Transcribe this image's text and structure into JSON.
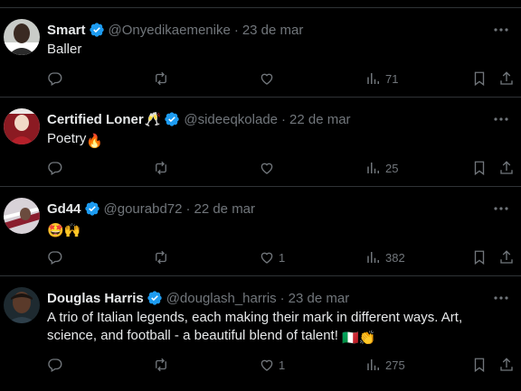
{
  "replies": [
    {
      "name": "Smart",
      "name_emoji": "",
      "handle": "@Onyedikaemenike",
      "date": "23 de mar",
      "text": "Baller",
      "text_emoji": "",
      "reply_count": "",
      "repost_count": "",
      "like_count": "",
      "views": "71"
    },
    {
      "name": "Certified Loner",
      "name_emoji": "🥂",
      "handle": "@sideeqkolade",
      "date": "22 de mar",
      "text": "Poetry",
      "text_emoji": "🔥",
      "reply_count": "",
      "repost_count": "",
      "like_count": "",
      "views": "25"
    },
    {
      "name": "Gd44",
      "name_emoji": "",
      "handle": "@gourabd72",
      "date": "22 de mar",
      "text": "",
      "text_emoji": "🤩🙌",
      "reply_count": "",
      "repost_count": "",
      "like_count": "1",
      "views": "382"
    },
    {
      "name": "Douglas Harris",
      "name_emoji": "",
      "handle": "@douglash_harris",
      "date": "23 de mar",
      "text": "A trio of Italian legends, each making their mark in different ways. Art, science, and football - a beautiful blend of talent!",
      "text_emoji": "🇮🇹👏",
      "reply_count": "",
      "repost_count": "",
      "like_count": "1",
      "views": "275"
    }
  ],
  "icons": {
    "verified": "verified-badge-icon",
    "more": "more-options-icon",
    "reply": "reply-icon",
    "repost": "repost-icon",
    "like": "heart-icon",
    "views": "views-icon",
    "bookmark": "bookmark-icon",
    "share": "share-icon"
  },
  "colors": {
    "background": "#000000",
    "text": "#e7e9ea",
    "secondary": "#71767b",
    "verified": "#1d9bf0",
    "divider": "#2f3336"
  }
}
